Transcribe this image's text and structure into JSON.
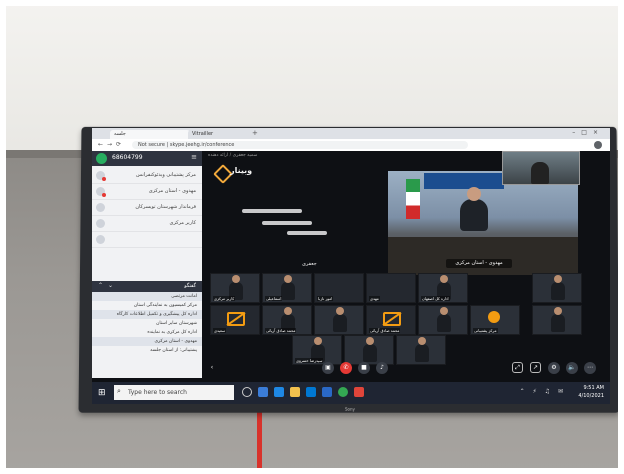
{
  "browser": {
    "tab1_label": "جلسه",
    "tab2_label": "Vitrailler",
    "url": "Not secure | skype.jeehg.ir/conference"
  },
  "sidebar": {
    "count": "68604799",
    "participants": [
      {
        "name": "مرکز پشتیبانی ویدئوکنفرانس"
      },
      {
        "name": "مهدوی - استان مرکزی"
      },
      {
        "name": "فرماندار شهرستان تویسرکان"
      },
      {
        "name": "کاربر مرکزی"
      },
      {
        "name": ""
      }
    ],
    "chat_title": "گفتگو",
    "messages": [
      "امانت مرتضی",
      "مرکز کمیسیون به نمایندگی استان",
      "اداره کل پیشگیری و تکمیل اطلاعات کارگاه",
      "شهرستان سایر استان",
      "اداره کل مرکزی به نماینده",
      "مهدوی - استان مرکزی",
      "پشتیبانی: از استان جلسه"
    ]
  },
  "stage": {
    "top_name": "سمیه جعفری / ارائه دهنده",
    "logo_text": "وبینار",
    "speaker_label": "جعفری",
    "main_name": "مهدوی - استان مرکزی",
    "tiles": [
      "کاربر مرکزی",
      "اسماعیلی",
      "امور نازبا",
      "مهدی",
      "اداره کل اصفهان",
      "",
      "سعیدی",
      "محمد صادق آرپائی",
      "",
      "مرکز پشتیبانی",
      "",
      "سیدرضا خسروی"
    ]
  },
  "taskbar": {
    "search_placeholder": "Type here to search",
    "time": "9:51 AM",
    "date": "4/10/2021"
  },
  "tv": {
    "brand": "Sony"
  }
}
